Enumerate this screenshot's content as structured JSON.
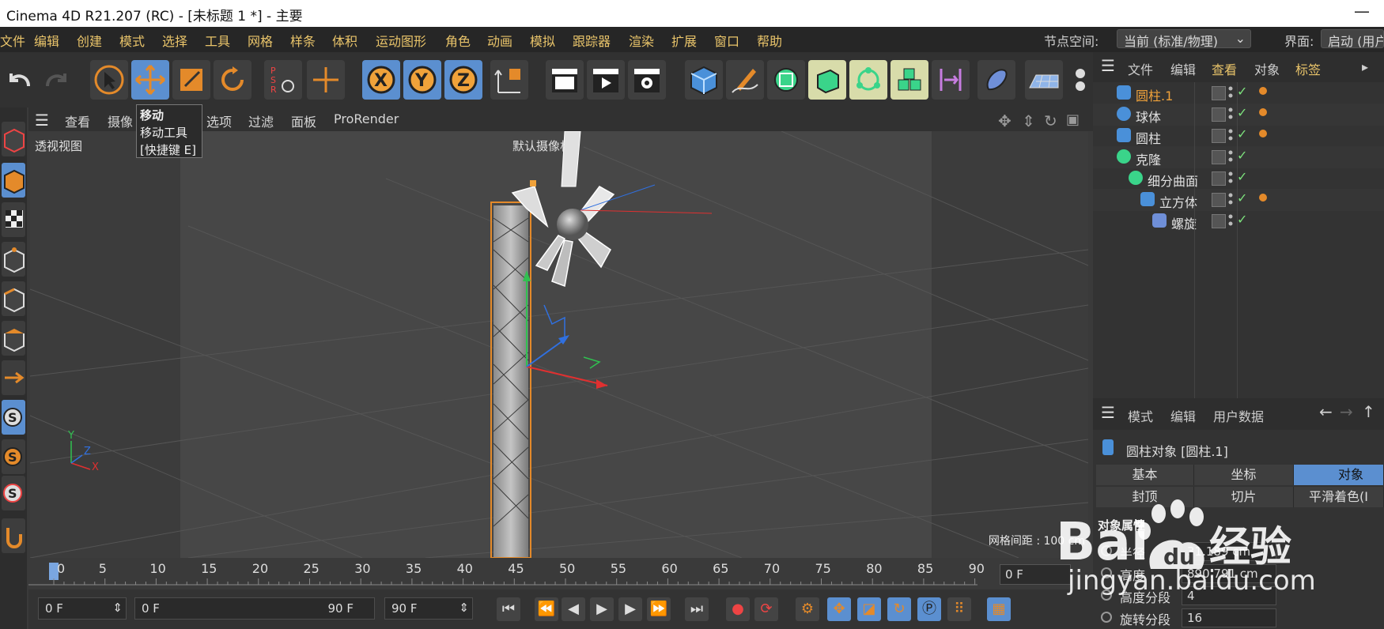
{
  "window": {
    "title": "Cinema 4D R21.207 (RC) - [未标题 1 *] - 主要",
    "minimize": "—"
  },
  "menubar": {
    "items": [
      "文件",
      "编辑",
      "创建",
      "模式",
      "选择",
      "工具",
      "网格",
      "样条",
      "体积",
      "运动图形",
      "角色",
      "动画",
      "模拟",
      "跟踪器",
      "渲染",
      "扩展",
      "窗口",
      "帮助"
    ],
    "node_space_label": "节点空间:",
    "node_space_value": "当前 (标准/物理)",
    "interface_label": "界面:",
    "interface_value": "启动 (用户"
  },
  "tooltip": {
    "title": "移动",
    "line1": "移动工具",
    "line2": "[快捷键 E]"
  },
  "viewport_menu": {
    "items": [
      "查看",
      "摄像",
      "选项",
      "过滤",
      "面板",
      "ProRender"
    ]
  },
  "viewport": {
    "view_label": "透视视图",
    "camera_label": "默认摄像机",
    "grid_spacing": "网格间距 : 100 cm",
    "axis_y": "Y",
    "axis_z": "Z",
    "axis_x": "X"
  },
  "timeline": {
    "ticks": [
      "0",
      "5",
      "10",
      "15",
      "20",
      "25",
      "30",
      "35",
      "40",
      "45",
      "50",
      "55",
      "60",
      "65",
      "70",
      "75",
      "80",
      "85",
      "90"
    ],
    "current_frame": "0 F"
  },
  "transport": {
    "start_frame": "0 F",
    "range_start": "0 F",
    "range_end": "90 F",
    "end_frame": "90 F"
  },
  "object_manager": {
    "menu": [
      "文件",
      "编辑",
      "查看",
      "对象",
      "标签"
    ],
    "objects": [
      {
        "name": "圆柱.1",
        "indent": 0,
        "selected": true,
        "icon": "cylinder-icon",
        "has_tag": true
      },
      {
        "name": "球体",
        "indent": 0,
        "selected": false,
        "icon": "sphere-icon",
        "has_tag": true
      },
      {
        "name": "圆柱",
        "indent": 0,
        "selected": false,
        "icon": "cylinder-icon",
        "has_tag": true
      },
      {
        "name": "克隆",
        "indent": 0,
        "selected": false,
        "icon": "cloner-icon",
        "has_tag": false
      },
      {
        "name": "细分曲面",
        "indent": 1,
        "selected": false,
        "icon": "subdivision-icon",
        "has_tag": false
      },
      {
        "name": "立方体",
        "indent": 2,
        "selected": false,
        "icon": "cube-icon",
        "has_tag": true
      },
      {
        "name": "螺旋",
        "indent": 3,
        "selected": false,
        "icon": "twist-icon",
        "has_tag": false
      }
    ]
  },
  "attribute_manager": {
    "menu": [
      "模式",
      "编辑",
      "用户数据"
    ],
    "title": "圆柱对象 [圆柱.1]",
    "tabs_row1": [
      "基本",
      "坐标",
      "对象"
    ],
    "tabs_row2": [
      "封顶",
      "切片",
      "平滑着色(I"
    ],
    "section": "对象属性",
    "props": [
      {
        "label": "半径",
        "value": "31.189 cm"
      },
      {
        "label": "高度",
        "value": "890.791 cm"
      },
      {
        "label": "高度分段",
        "value": "4"
      },
      {
        "label": "旋转分段",
        "value": "16"
      }
    ]
  },
  "watermark": {
    "brand_left": "Bai",
    "brand_right": "经验",
    "url": "jingyan.baidu.com"
  },
  "colors": {
    "accent": "#5b8fd0",
    "menu_text": "#e9c46a",
    "selection": "#e48a2a"
  }
}
